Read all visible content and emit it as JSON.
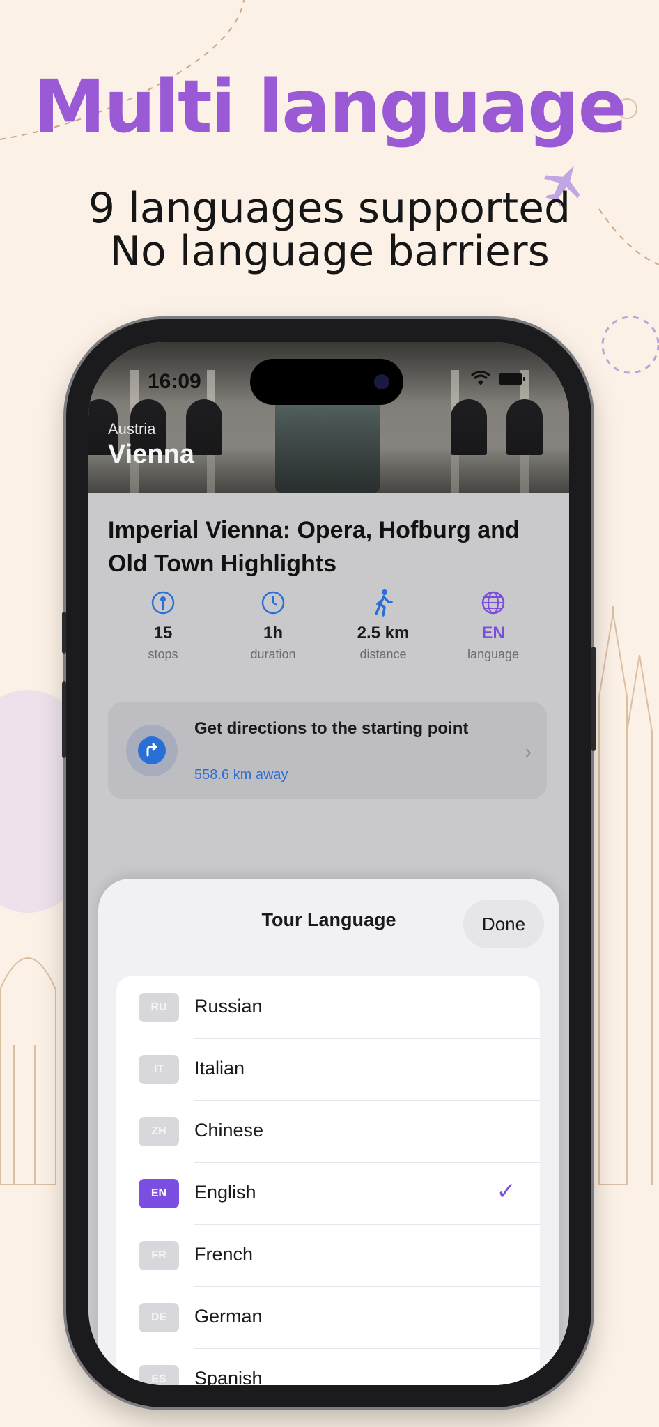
{
  "promo": {
    "headline": "Multi language",
    "subline1": "9 languages supported",
    "subline2": "No language barriers"
  },
  "status_bar": {
    "time": "16:09"
  },
  "hero": {
    "country": "Austria",
    "city": "Vienna"
  },
  "tour": {
    "title": "Imperial Vienna: Opera, Hofburg and Old Town Highlights",
    "stats": [
      {
        "icon": "pin-icon",
        "value": "15",
        "label": "stops"
      },
      {
        "icon": "clock-icon",
        "value": "1h",
        "label": "duration"
      },
      {
        "icon": "walk-icon",
        "value": "2.5 km",
        "label": "distance"
      },
      {
        "icon": "globe-icon",
        "value": "EN",
        "label": "language"
      }
    ]
  },
  "directions": {
    "title": "Get directions to the starting point",
    "distance": "558.6 km away"
  },
  "language_sheet": {
    "title": "Tour Language",
    "done_label": "Done",
    "selected_code": "EN",
    "languages": [
      {
        "code": "RU",
        "name": "Russian"
      },
      {
        "code": "IT",
        "name": "Italian"
      },
      {
        "code": "ZH",
        "name": "Chinese"
      },
      {
        "code": "EN",
        "name": "English",
        "check": "✓"
      },
      {
        "code": "FR",
        "name": "French"
      },
      {
        "code": "DE",
        "name": "German"
      },
      {
        "code": "ES",
        "name": "Spanish"
      }
    ]
  },
  "colors": {
    "accent_purple": "#9a5ad6",
    "selected_badge": "#7b4ee0",
    "link_blue": "#2c6fd4",
    "icon_blue": "#2a6fd6"
  }
}
